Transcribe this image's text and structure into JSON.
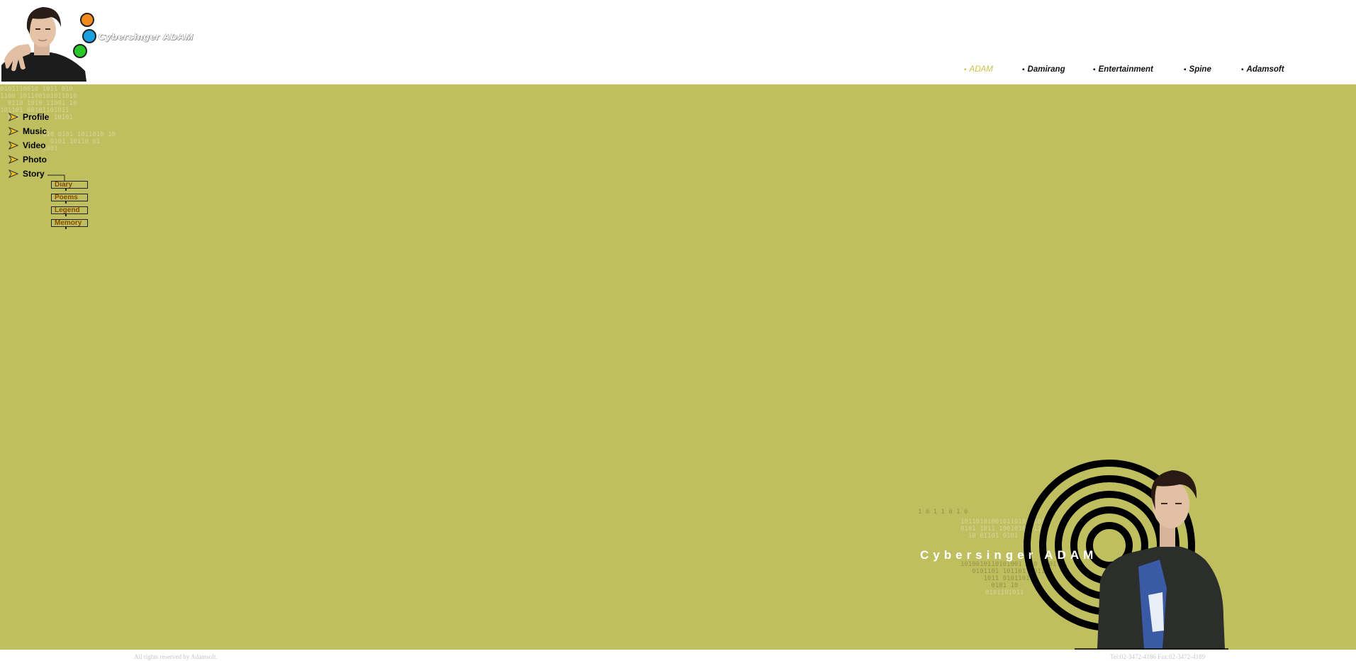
{
  "header": {
    "logo_text": "Cybersinger ADAM",
    "logo_dot_colors": [
      "#f08a1c",
      "#1aa0e0",
      "#28c828"
    ]
  },
  "topnav": {
    "items": [
      {
        "label": "ADAM",
        "active": true
      },
      {
        "label": "Damirang",
        "active": false
      },
      {
        "label": "Entertainment",
        "active": false
      },
      {
        "label": "Spine",
        "active": false
      },
      {
        "label": "Adamsoft",
        "active": false
      }
    ]
  },
  "sidebar": {
    "items": [
      {
        "label": "Profile"
      },
      {
        "label": "Music"
      },
      {
        "label": "Video"
      },
      {
        "label": "Photo"
      },
      {
        "label": "Story"
      }
    ],
    "story_submenu": [
      {
        "label": "Diary"
      },
      {
        "label": "Poems"
      },
      {
        "label": "Legend"
      },
      {
        "label": "Memory"
      }
    ]
  },
  "hero": {
    "title": "Cybersinger ADAM"
  },
  "footer": {
    "copyright": "All rights reserved by Adamsoft.",
    "contact": "Tel:02-3472-4186    Fax:02-3472-4189"
  },
  "colors": {
    "main_bg": "#bfbf60",
    "arrow_fill": "#f0c020",
    "sub_text": "#8a4a00"
  }
}
